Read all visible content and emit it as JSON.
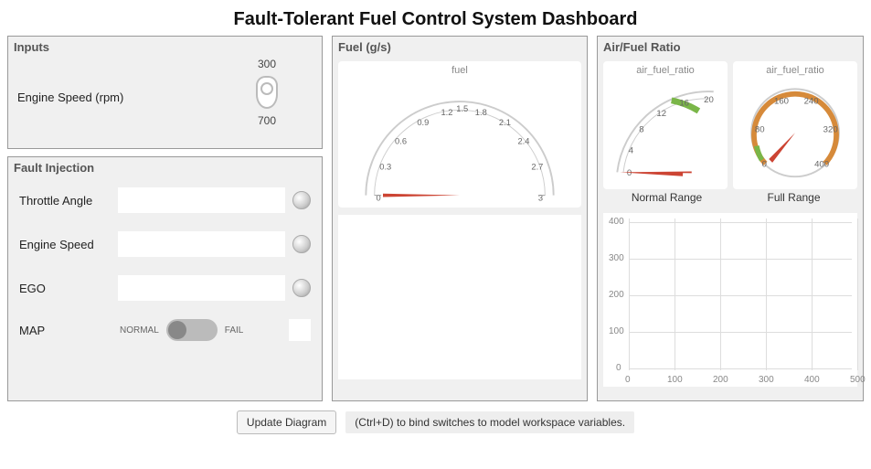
{
  "title": "Fault-Tolerant Fuel Control System Dashboard",
  "inputs": {
    "panel_title": "Inputs",
    "engine_speed_label": "Engine Speed (rpm)",
    "value_top": "300",
    "value_bottom": "700"
  },
  "fault": {
    "panel_title": "Fault Injection",
    "rows": [
      {
        "label": "Throttle Angle",
        "value": ""
      },
      {
        "label": "Engine Speed",
        "value": ""
      },
      {
        "label": "EGO",
        "value": ""
      }
    ],
    "map": {
      "label": "MAP",
      "left": "NORMAL",
      "right": "FAIL",
      "state": "normal"
    }
  },
  "fuel": {
    "panel_title": "Fuel (g/s)",
    "gauge_caption": "fuel",
    "gauge_min": 0,
    "gauge_max": 3,
    "gauge_ticks": [
      "0",
      "0.3",
      "0.6",
      "0.9",
      "1.2",
      "1.5",
      "1.8",
      "2.1",
      "2.4",
      "2.7",
      "3"
    ],
    "gauge_value": 0
  },
  "airfuel": {
    "panel_title": "Air/Fuel Ratio",
    "gauge_caption": "air_fuel_ratio",
    "normal": {
      "label": "Normal Range",
      "min": 0,
      "max": 20,
      "ticks": [
        "0",
        "4",
        "8",
        "12",
        "16",
        "20"
      ],
      "green_start": 12,
      "green_end": 16,
      "value": 0
    },
    "full": {
      "label": "Full Range",
      "min": 0,
      "max": 400,
      "ticks": [
        "0",
        "80",
        "160",
        "240",
        "320",
        "400"
      ],
      "green_start": 0,
      "green_end": 40,
      "value": 0
    },
    "plot": {
      "x_min": 0,
      "x_max": 500,
      "x_ticks": [
        "0",
        "100",
        "200",
        "300",
        "400",
        "500"
      ],
      "y_min": 0,
      "y_max": 400,
      "y_ticks": [
        "0",
        "100",
        "200",
        "300",
        "400"
      ]
    }
  },
  "footer": {
    "button": "Update Diagram",
    "hint": "(Ctrl+D) to bind switches to model workspace variables."
  },
  "colors": {
    "needle": "#cc4433",
    "arc_orange": "#d68a3a",
    "arc_green": "#7ab648"
  }
}
